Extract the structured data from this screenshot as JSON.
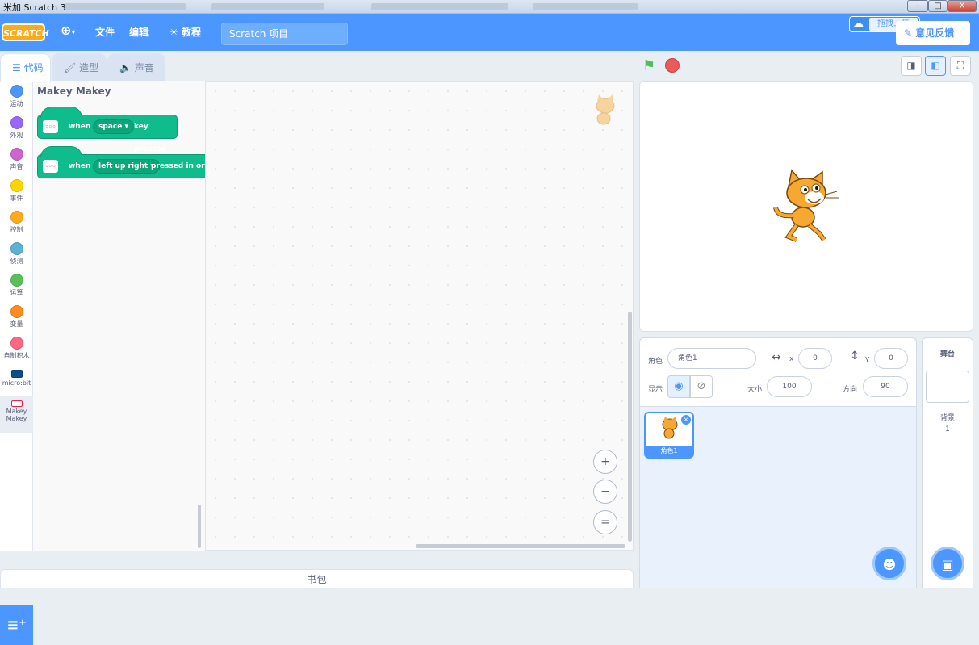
{
  "window": {
    "title": "米加 Scratch 3",
    "minimize": "–",
    "maximize": "□",
    "close": "X"
  },
  "menubar": {
    "logo": "SCRATCH",
    "language_icon": "globe-icon",
    "language_arrow": "▾",
    "file": "文件",
    "edit": "编辑",
    "tutorials": "教程",
    "project_name": "Scratch 项目",
    "upload": "拖拽上传",
    "feedback": "意见反馈"
  },
  "tabs": [
    {
      "label": "代码"
    },
    {
      "label": "造型"
    },
    {
      "label": "声音"
    }
  ],
  "categories": [
    {
      "label": "运动",
      "color": "#4c97ff"
    },
    {
      "label": "外观",
      "color": "#9966ff"
    },
    {
      "label": "声音",
      "color": "#cf63cf"
    },
    {
      "label": "事件",
      "color": "#ffd500"
    },
    {
      "label": "控制",
      "color": "#ffab19"
    },
    {
      "label": "侦测",
      "color": "#5cb1d6"
    },
    {
      "label": "运算",
      "color": "#59c059"
    },
    {
      "label": "变量",
      "color": "#ff8c1a"
    },
    {
      "label": "自制积木",
      "color": "#ff6680"
    },
    {
      "label": "micro:bit",
      "color": "#0b4f8a"
    },
    {
      "label": "Makey Makey",
      "color": "#e9eef2"
    }
  ],
  "flyout": {
    "title": "Makey Makey",
    "blocks": [
      {
        "when": "when",
        "dropdown": "space",
        "suffix": "key pressed"
      },
      {
        "when": "when",
        "dropdown": "left up right",
        "suffix": "pressed in order"
      }
    ]
  },
  "zoom": {
    "in": "+",
    "out": "−",
    "reset": "="
  },
  "backpack": "书包",
  "sprite_info": {
    "sprite_label": "角色",
    "sprite_name": "角色1",
    "x_label": "x",
    "x_value": "0",
    "y_label": "y",
    "y_value": "0",
    "show_label": "显示",
    "size_label": "大小",
    "size_value": "100",
    "direction_label": "方向",
    "direction_value": "90"
  },
  "sprites": [
    {
      "name": "角色1"
    }
  ],
  "stage_pane": {
    "title": "舞台",
    "backdrops_label": "背景",
    "backdrops_count": "1"
  },
  "colors": {
    "accent": "#4c97ff",
    "makey": "#0fbd8c"
  }
}
